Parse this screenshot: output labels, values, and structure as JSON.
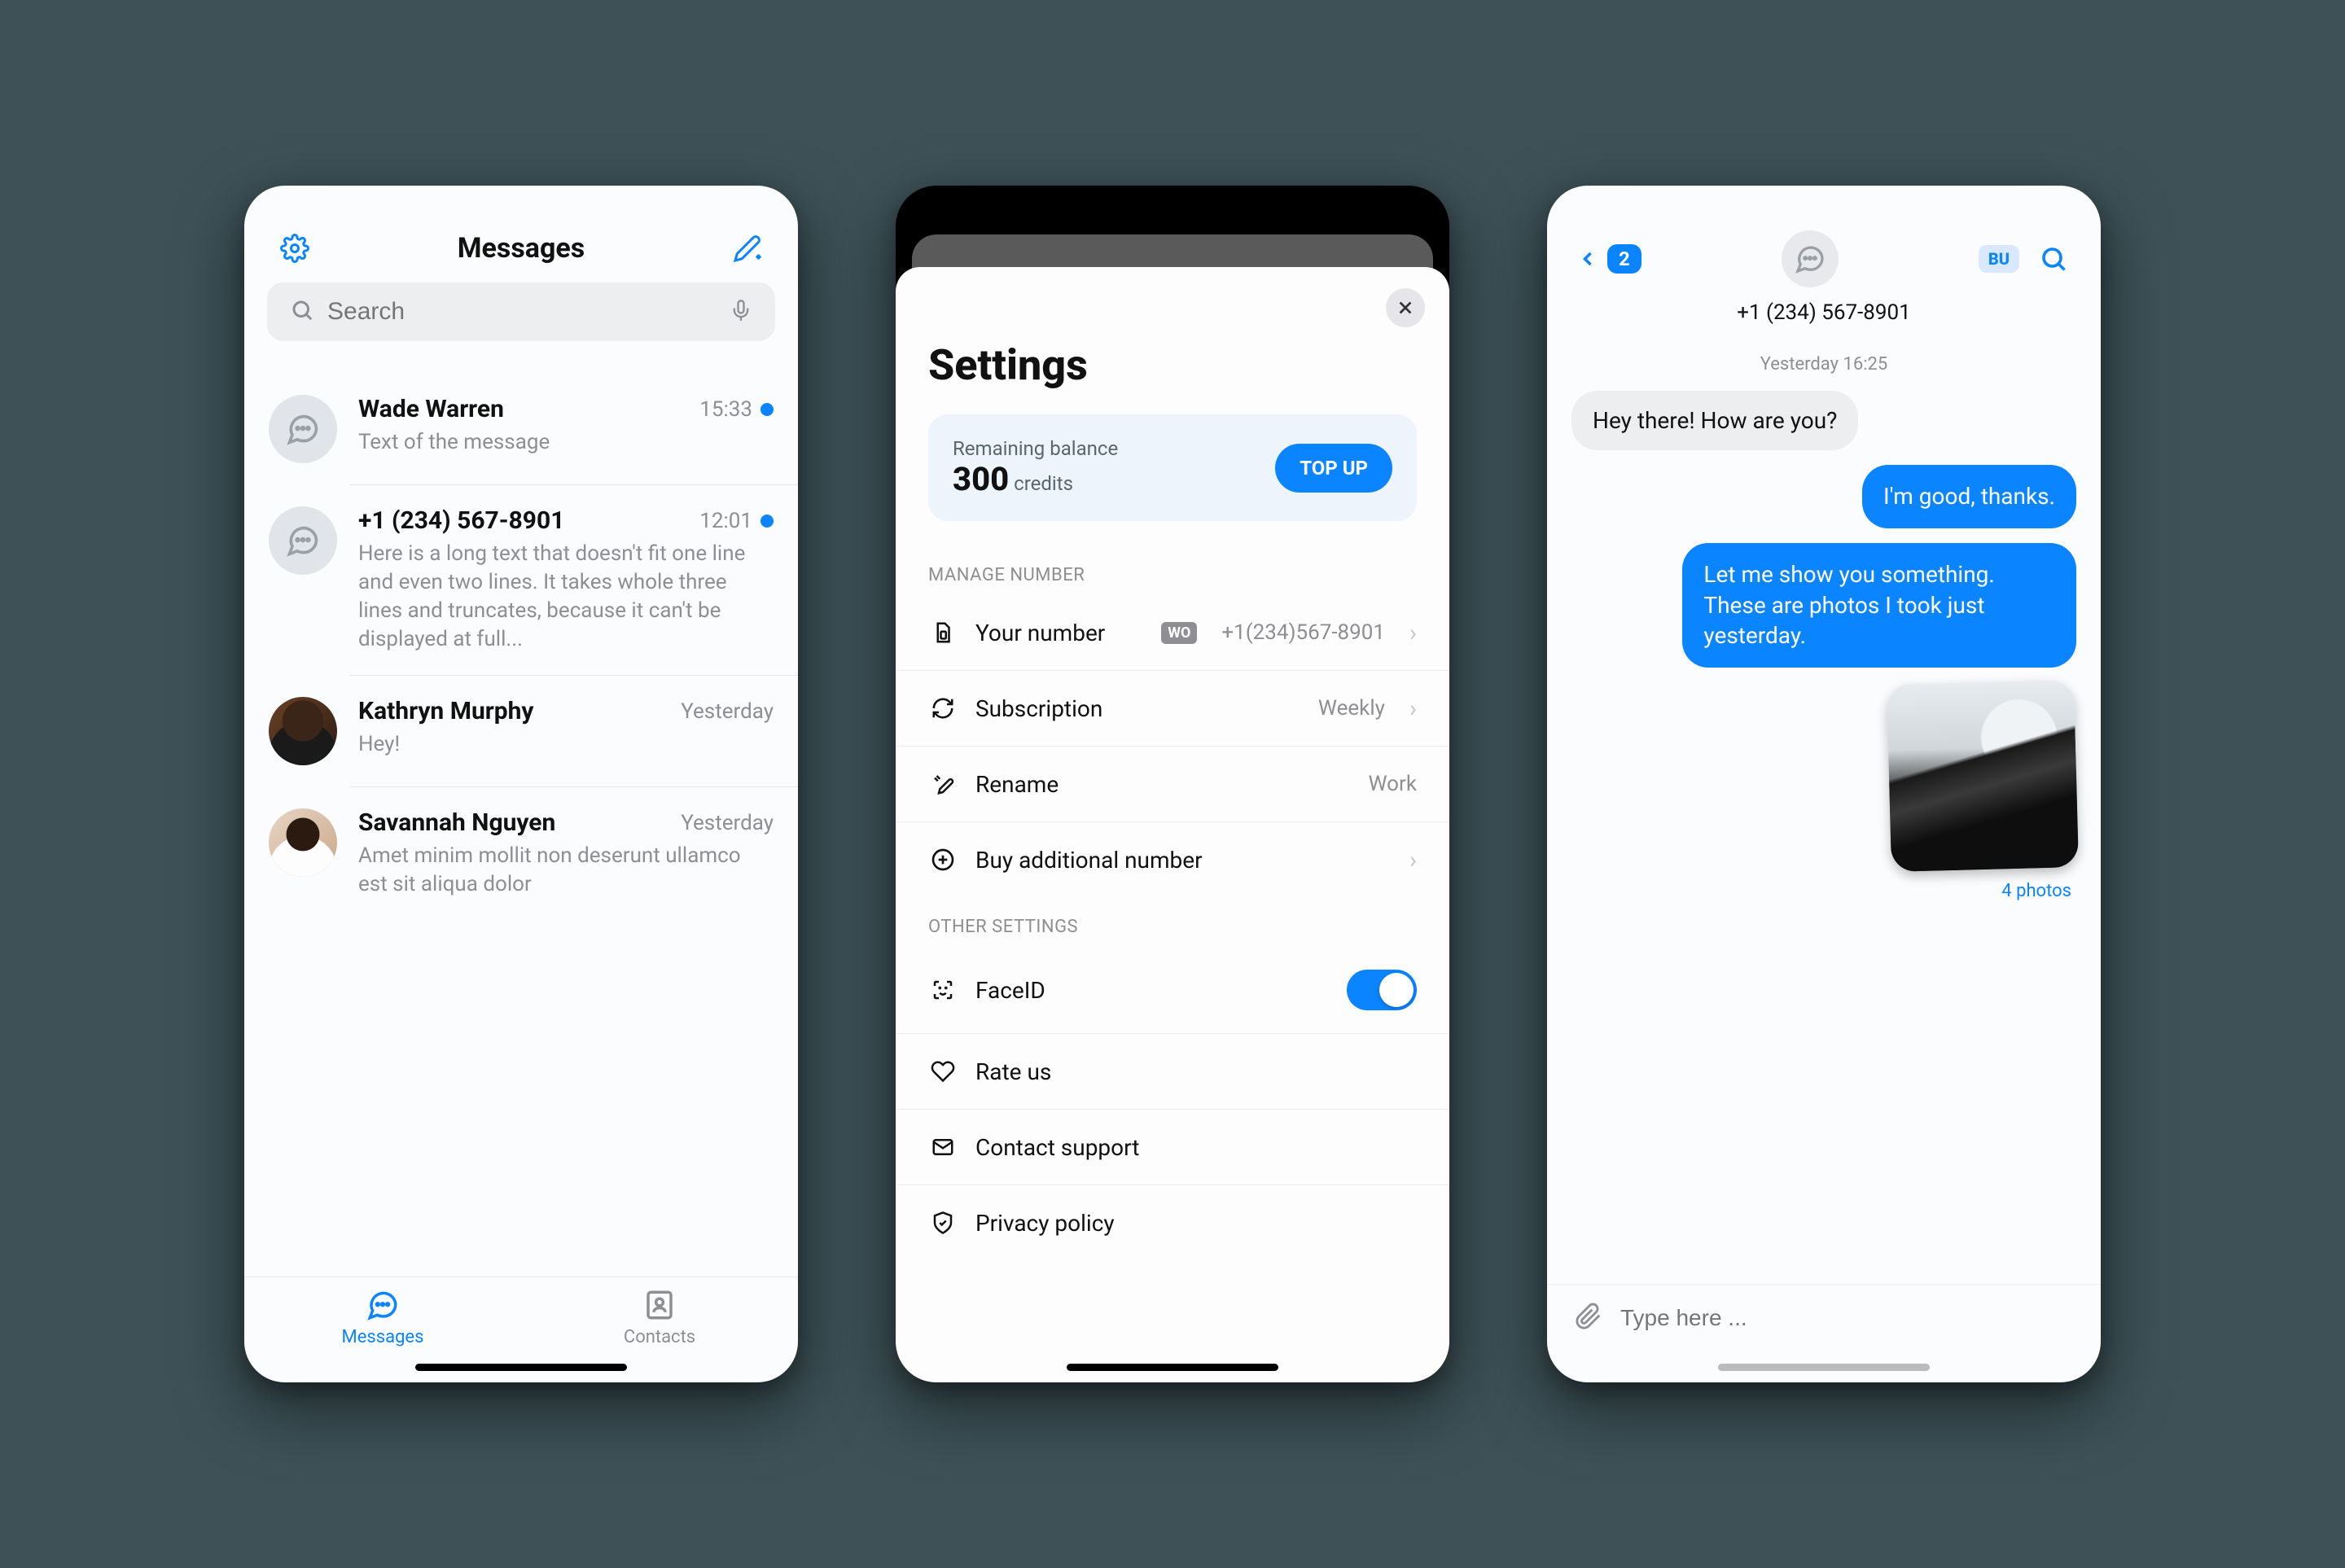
{
  "screen1": {
    "title": "Messages",
    "search_placeholder": "Search",
    "conversations": [
      {
        "name": "Wade Warren",
        "time": "15:33",
        "unread": true,
        "preview": "Text of the message",
        "avatar": "bubble"
      },
      {
        "name": "+1 (234) 567-8901",
        "time": "12:01",
        "unread": true,
        "preview": "Here is a long text that doesn't fit one line and even two lines. It takes whole three lines and truncates, because it can't be displayed at full...",
        "avatar": "bubble"
      },
      {
        "name": "Kathryn Murphy",
        "time": "Yesterday",
        "unread": false,
        "preview": "Hey!",
        "avatar": "photo1"
      },
      {
        "name": "Savannah Nguyen",
        "time": "Yesterday",
        "unread": false,
        "preview": "Amet minim mollit non deserunt ullamco est sit aliqua dolor",
        "avatar": "photo2"
      }
    ],
    "tabs": {
      "messages": "Messages",
      "contacts": "Contacts"
    }
  },
  "screen2": {
    "title": "Settings",
    "balance_label": "Remaining balance",
    "balance_amount": "300",
    "balance_unit": " credits",
    "topup": "TOP UP",
    "sections": {
      "manage_number": "MANAGE NUMBER",
      "other_settings": "OTHER SETTINGS"
    },
    "your_number_label": "Your number",
    "your_number_badge": "WO",
    "your_number_value": "+1(234)567-8901",
    "subscription_label": "Subscription",
    "subscription_value": "Weekly",
    "rename_label": "Rename",
    "rename_value": "Work",
    "buy_label": "Buy additional number",
    "faceid_label": "FaceID",
    "faceid_on": true,
    "rate_label": "Rate us",
    "support_label": "Contact support",
    "privacy_label": "Privacy policy"
  },
  "screen3": {
    "back_count": "2",
    "pill": "BU",
    "phone": "+1 (234) 567-8901",
    "timestamp": "Yesterday 16:25",
    "messages": {
      "incoming1": "Hey there! How are you?",
      "outgoing1": "I'm good, thanks.",
      "outgoing2": "Let me show you something. These are photos I took just yesterday."
    },
    "photo_caption": "4 photos",
    "composer_placeholder": "Type here ..."
  }
}
